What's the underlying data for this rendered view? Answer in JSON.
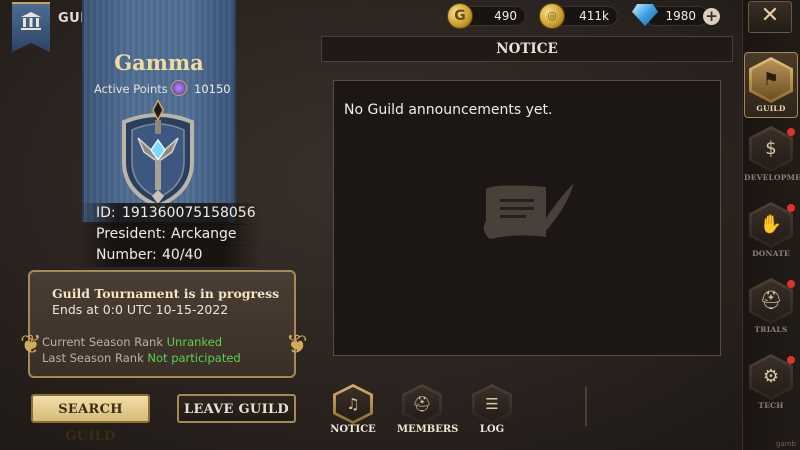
{
  "header": {
    "title": "GUILD",
    "currencies": [
      {
        "icon": "gold-coin-icon",
        "value": "490"
      },
      {
        "icon": "coin-stack-icon",
        "value": "411k"
      },
      {
        "icon": "diamond-icon",
        "value": "1980"
      }
    ]
  },
  "guild": {
    "name": "Gamma",
    "active_points_label": "Active Points",
    "active_points": "10150",
    "id_label": "ID:",
    "id": "191360075158056",
    "president_label": "President:",
    "president": "Arckange",
    "number_label": "Number:",
    "number": "40/40"
  },
  "tournament": {
    "title": "Guild Tournament is in progress",
    "ends": "Ends at 0:0 UTC 10-15-2022",
    "current_rank_label": "Current Season Rank",
    "current_rank": "Unranked",
    "last_rank_label": "Last Season Rank",
    "last_rank": "Not participated"
  },
  "buttons": {
    "search": "SEARCH GUILD",
    "leave": "LEAVE GUILD"
  },
  "notice": {
    "header": "NOTICE",
    "text": "No Guild announcements yet."
  },
  "tabs": [
    {
      "label": "NOTICE",
      "icon": "horn-icon",
      "active": true
    },
    {
      "label": "MEMBERS",
      "icon": "helmet-icon",
      "active": false
    },
    {
      "label": "LOG",
      "icon": "scroll-icon",
      "active": false
    }
  ],
  "sidebar": [
    {
      "label": "GUILD",
      "icon": "banner-icon",
      "active": true,
      "alert": false
    },
    {
      "label": "DEVELOPMENT",
      "icon": "money-bag-icon",
      "active": false,
      "alert": true
    },
    {
      "label": "DONATE",
      "icon": "hands-icon",
      "active": false,
      "alert": true
    },
    {
      "label": "TRIALS",
      "icon": "helmet-icon",
      "active": false,
      "alert": true
    },
    {
      "label": "TECH",
      "icon": "gear-icon",
      "active": false,
      "alert": true
    }
  ],
  "watermark": "gamb"
}
